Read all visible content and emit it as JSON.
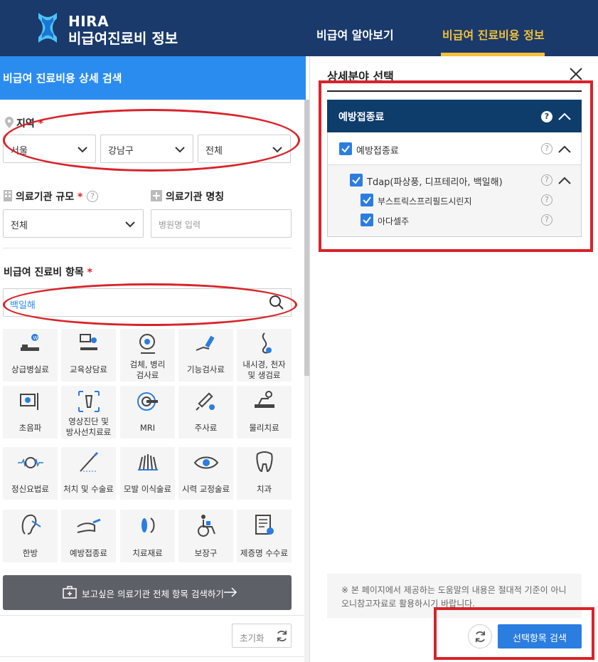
{
  "header": {
    "logo_line1": "HIRA",
    "logo_line2": "비급여진료비 정보",
    "nav": [
      "비급여 알아보기",
      "비급여 진료비용 정보"
    ],
    "brand_color": "#1a3a6b",
    "active_color": "#f3c13a"
  },
  "left": {
    "title": "비급여 진료비용 상세 검색",
    "region": {
      "label": "지역",
      "required_mark": "*",
      "selects": [
        "서울",
        "강남구",
        "전체"
      ]
    },
    "scale": {
      "label": "의료기관 규모",
      "required_mark": "*",
      "value": "전체"
    },
    "name": {
      "label": "의료기관 명칭",
      "placeholder": "병원명 입력"
    },
    "items": {
      "label": "비급여 진료비 항목",
      "required_mark": "*",
      "search_value": "백일해"
    },
    "tiles": [
      [
        "상급병실료",
        ""
      ],
      [
        "교육상담료",
        ""
      ],
      [
        "검체, 병리",
        "검사료"
      ],
      [
        "기능검사료",
        ""
      ],
      [
        "내시경, 천자",
        "및 생검료"
      ],
      [
        "초음파",
        ""
      ],
      [
        "영상진단 및",
        "방사선치료료"
      ],
      [
        "MRI",
        ""
      ],
      [
        "주사료",
        ""
      ],
      [
        "물리치료",
        ""
      ],
      [
        "정신요법료",
        ""
      ],
      [
        "처치 및 수술료",
        ""
      ],
      [
        "모발 이식술료",
        ""
      ],
      [
        "시력 교정술료",
        ""
      ],
      [
        "치과",
        ""
      ],
      [
        "한방",
        ""
      ],
      [
        "예방접종료",
        ""
      ],
      [
        "치료재료",
        ""
      ],
      [
        "보장구",
        ""
      ],
      [
        "제증명 수수료",
        ""
      ]
    ],
    "search_all_button": "보고싶은 의료기관 전체 항목 검색하기",
    "reset_button": "초기화"
  },
  "right": {
    "title": "상세분야 선택",
    "category": "예방접종료",
    "level1": "예방접종료",
    "level2": "Tdap(파상풍, 디프테리아, 백일해)",
    "level3": [
      "부스트릭스프리필드시린지",
      "아다셀주"
    ],
    "help_glyph": "?",
    "note": "※ 본 페이지에서 제공하는 도움말의 내용은 절대적 기준이 아니오니참고자료로 활용하시기 바랍니다.",
    "search_button": "선택항목 검색",
    "accent_color": "#2b7de0"
  }
}
